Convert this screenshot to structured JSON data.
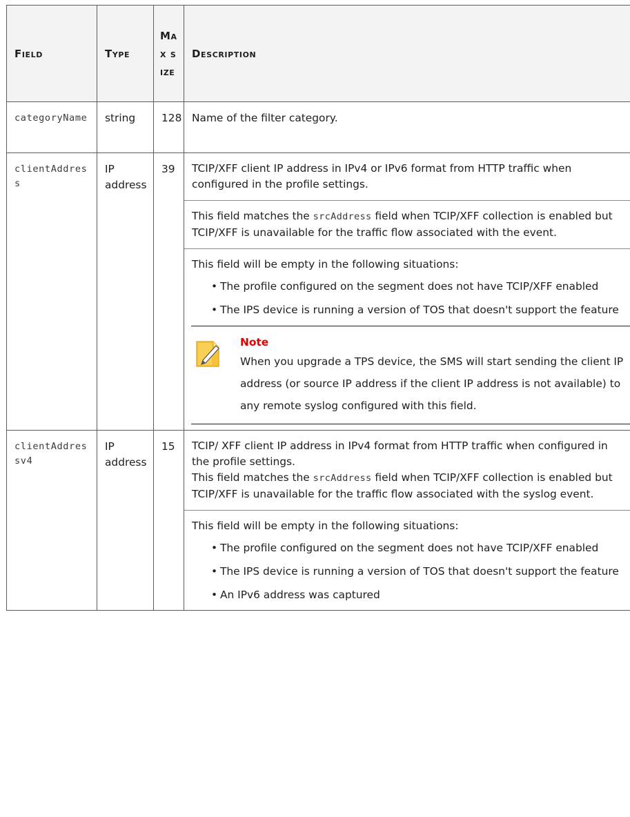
{
  "headers": {
    "field": "Field",
    "type": "Type",
    "max": "Max size",
    "description": "Description"
  },
  "rows": [
    {
      "field": "categoryName",
      "type": "string",
      "max": "128",
      "desc": "Name of the filter category."
    },
    {
      "field": "clientAddress",
      "type": "IP address",
      "max": "39",
      "p1": "TCIP/XFF client IP address in IPv4 or IPv6 format from HTTP traffic when configured in the profile settings.",
      "p2_pre": "This field matches the ",
      "p2_code": "srcAddress",
      "p2_post": " field when TCIP/XFF collection is enabled but TCIP/XFF is unavailable for the traffic flow associated with the event.",
      "p3": "This field will be empty in the following situations:",
      "bullets": [
        "The profile configured on the segment does not have TCIP/XFF enabled",
        "The IPS device is running a version of TOS that doesn't support the feature"
      ],
      "note_title": "Note",
      "note_body": "When you upgrade a TPS device, the SMS will start sending the client IP address (or source IP address if the client IP address is not available) to any remote syslog configured with this field."
    },
    {
      "field": "clientAddressv4",
      "type": "IP address",
      "max": "15",
      "p1": "TCIP/ XFF client IP address in IPv4 format from HTTP traffic when configured in the profile settings.",
      "p2_pre": "This field matches the ",
      "p2_code": "srcAddress",
      "p2_post": " field when TCIP/XFF collection is enabled but TCIP/XFF is unavailable for the traffic flow associated with the syslog event.",
      "p3": "This field will be empty in the following situations:",
      "bullets": [
        "The profile configured on the segment does not have TCIP/XFF enabled",
        "The IPS device is running a version of TOS that doesn't support the feature",
        "An IPv6 address was captured"
      ]
    }
  ],
  "colors": {
    "note_title": "#e00000",
    "icon_fill": "#f5c23c",
    "border": "#5c5c5c"
  },
  "icons": {
    "note": "note-pencil-icon"
  }
}
